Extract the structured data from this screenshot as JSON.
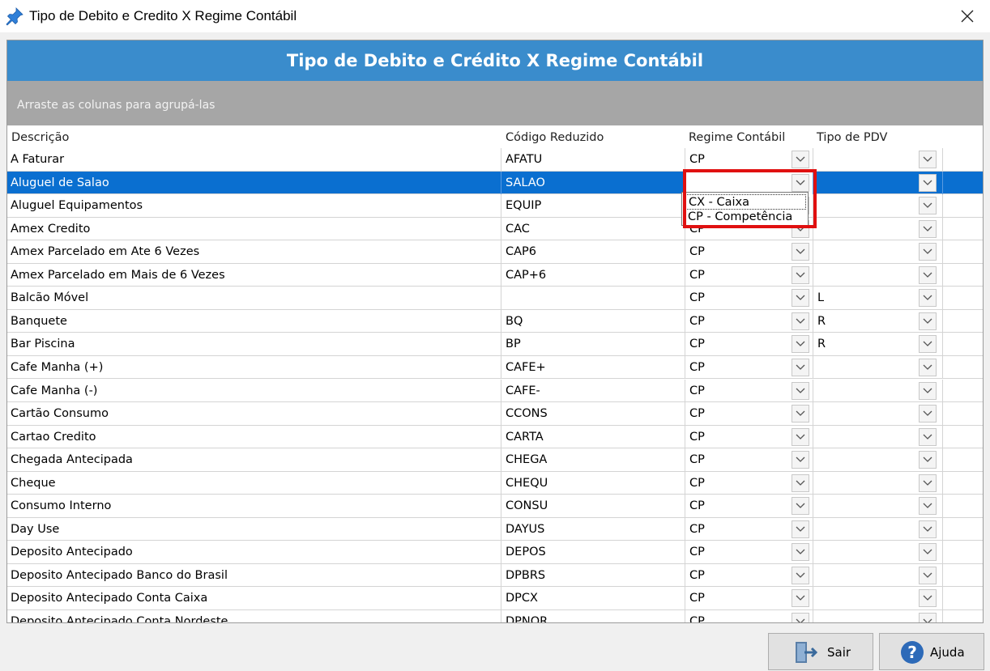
{
  "window": {
    "title": "Tipo de Debito e Credito X Regime Contábil",
    "close_icon": "close-icon"
  },
  "banner": {
    "title": "Tipo de Debito e Crédito X Regime Contábil"
  },
  "group_hint": "Arraste as colunas para agrupá-las",
  "columns": [
    "Descrição",
    "Código Reduzido",
    "Regime Contábil",
    "Tipo de PDV"
  ],
  "rows": [
    {
      "descricao": "A Faturar",
      "codigo": "AFATU",
      "regime": "CP",
      "pdv": ""
    },
    {
      "descricao": "Aluguel de Salao",
      "codigo": "SALAO",
      "regime": "",
      "pdv": ""
    },
    {
      "descricao": "Aluguel Equipamentos",
      "codigo": "EQUIP",
      "regime": "",
      "pdv": ""
    },
    {
      "descricao": "Amex Credito",
      "codigo": "CAC",
      "regime": "CP",
      "pdv": ""
    },
    {
      "descricao": "Amex Parcelado em Ate 6 Vezes",
      "codigo": "CAP6",
      "regime": "CP",
      "pdv": ""
    },
    {
      "descricao": "Amex Parcelado em Mais de 6 Vezes",
      "codigo": "CAP+6",
      "regime": "CP",
      "pdv": ""
    },
    {
      "descricao": "Balcão Móvel",
      "codigo": "",
      "regime": "CP",
      "pdv": "L"
    },
    {
      "descricao": "Banquete",
      "codigo": "BQ",
      "regime": "CP",
      "pdv": "R"
    },
    {
      "descricao": "Bar Piscina",
      "codigo": "BP",
      "regime": "CP",
      "pdv": "R"
    },
    {
      "descricao": "Cafe Manha (+)",
      "codigo": "CAFE+",
      "regime": "CP",
      "pdv": ""
    },
    {
      "descricao": "Cafe Manha (-)",
      "codigo": "CAFE-",
      "regime": "CP",
      "pdv": ""
    },
    {
      "descricao": "Cartão Consumo",
      "codigo": "CCONS",
      "regime": "CP",
      "pdv": ""
    },
    {
      "descricao": "Cartao Credito",
      "codigo": "CARTA",
      "regime": "CP",
      "pdv": ""
    },
    {
      "descricao": "Chegada Antecipada",
      "codigo": "CHEGA",
      "regime": "CP",
      "pdv": ""
    },
    {
      "descricao": "Cheque",
      "codigo": "CHEQU",
      "regime": "CP",
      "pdv": ""
    },
    {
      "descricao": "Consumo Interno",
      "codigo": "CONSU",
      "regime": "CP",
      "pdv": ""
    },
    {
      "descricao": "Day Use",
      "codigo": "DAYUS",
      "regime": "CP",
      "pdv": ""
    },
    {
      "descricao": "Deposito Antecipado",
      "codigo": "DEPOS",
      "regime": "CP",
      "pdv": ""
    },
    {
      "descricao": "Deposito Antecipado Banco do Brasil",
      "codigo": "DPBRS",
      "regime": "CP",
      "pdv": ""
    },
    {
      "descricao": "Deposito Antecipado Conta Caixa",
      "codigo": "DPCX",
      "regime": "CP",
      "pdv": ""
    },
    {
      "descricao": "Deposito Antecipado Conta Nordeste",
      "codigo": "DPNOR",
      "regime": "CP",
      "pdv": ""
    }
  ],
  "selected_row": 1,
  "regime_dropdown": {
    "options": [
      "CX - Caixa",
      "CP - Competência"
    ]
  },
  "buttons": {
    "sair": "Sair",
    "ajuda": "Ajuda"
  },
  "colors": {
    "banner": "#3a8ccc",
    "selection": "#0a6fd0",
    "highlight": "#e01010",
    "group_bar": "#a6a6a6"
  }
}
